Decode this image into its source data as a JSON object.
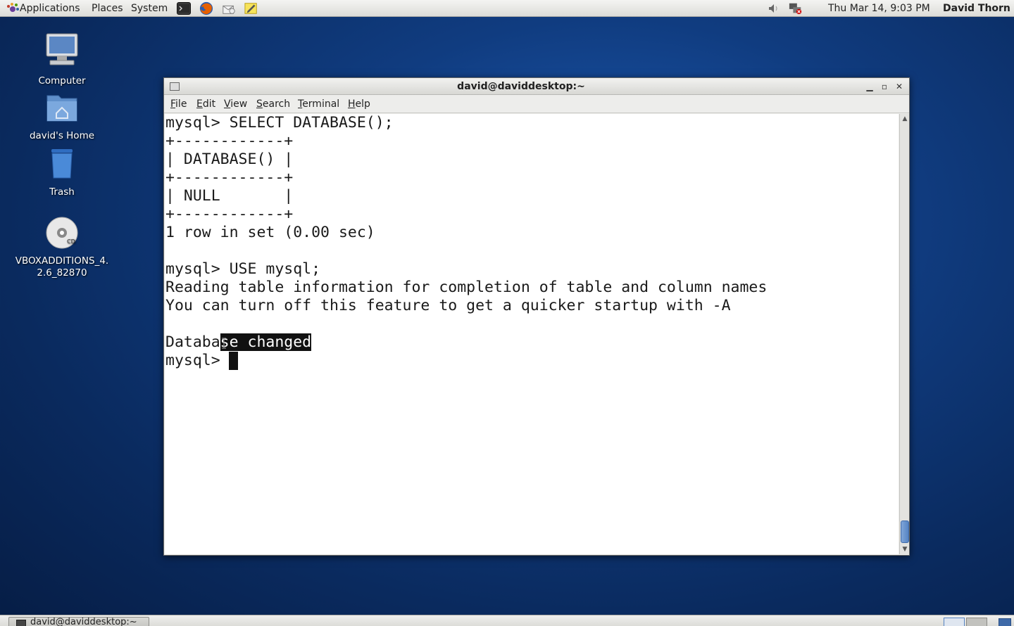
{
  "top_panel": {
    "menus": [
      "Applications",
      "Places",
      "System"
    ],
    "launchers": [
      "terminal-launcher-icon",
      "firefox-icon",
      "mail-icon",
      "text-editor-icon"
    ],
    "clock": "Thu Mar 14,  9:03 PM",
    "user": "David Thorn",
    "tray_icons": [
      "volume-icon",
      "network-icon"
    ]
  },
  "desktop_icons": [
    {
      "label": "Computer",
      "icon": "computer-icon"
    },
    {
      "label": "david's Home",
      "icon": "home-folder-icon"
    },
    {
      "label": "Trash",
      "icon": "trash-icon"
    },
    {
      "label": "VBOXADDITIONS_4.2.6_82870",
      "label_line1": "VBOXADDITIONS_4.",
      "label_line2": "2.6_82870",
      "icon": "cd-icon"
    }
  ],
  "window": {
    "title": "david@daviddesktop:~",
    "menus": [
      {
        "ul": "F",
        "rest": "ile"
      },
      {
        "ul": "E",
        "rest": "dit"
      },
      {
        "ul": "V",
        "rest": "iew"
      },
      {
        "ul": "S",
        "rest": "earch"
      },
      {
        "ul": "T",
        "rest": "erminal"
      },
      {
        "ul": "H",
        "rest": "elp"
      }
    ]
  },
  "terminal": {
    "lines": [
      "mysql> SELECT DATABASE();",
      "+------------+",
      "| DATABASE() |",
      "+------------+",
      "| NULL       |",
      "+------------+",
      "1 row in set (0.00 sec)",
      "",
      "mysql> USE mysql;",
      "Reading table information for completion of table and column names",
      "You can turn off this feature to get a quicker startup with -A",
      ""
    ],
    "selected_line_before": "Databa",
    "selected_line_selection": "se changed",
    "prompt": "mysql> "
  },
  "taskbar": {
    "task": "david@daviddesktop:~"
  },
  "colors": {
    "selection": "#111111",
    "scroll_thumb": "#5584c4"
  }
}
